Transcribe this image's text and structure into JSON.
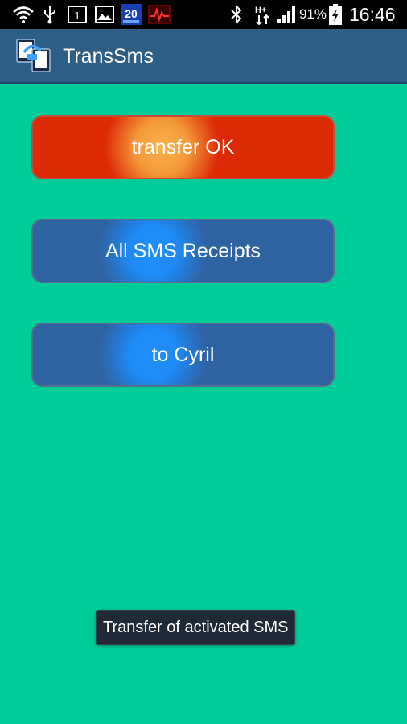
{
  "status_bar": {
    "battery_percent": "91%",
    "time": "16:46",
    "network_label": "H+",
    "calendar_day": "1",
    "clock_widget": "20"
  },
  "app": {
    "title": "TransSms"
  },
  "buttons": {
    "transfer": "transfer OK",
    "all_sms": "All SMS Receipts",
    "to_contact": "to Cyril"
  },
  "toast": {
    "message": "Transfer of activated SMS"
  },
  "colors": {
    "background": "#00cc99",
    "action_bar": "#2d5e85",
    "button_red": "#dc2a06",
    "button_blue": "#2f62a1",
    "toast": "#1f2a36"
  }
}
